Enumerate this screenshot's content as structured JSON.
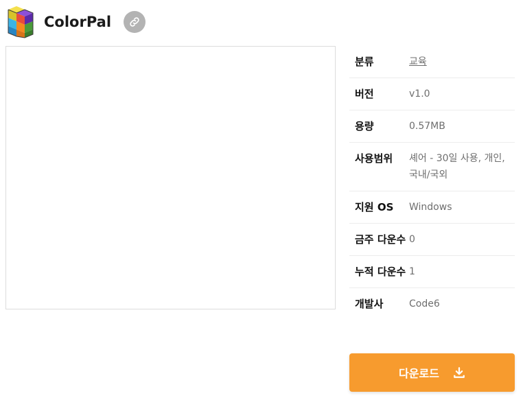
{
  "app": {
    "title": "ColorPal",
    "logo_icon": "colored-cubes-icon",
    "link_icon": "link-icon"
  },
  "info": [
    {
      "label": "분류",
      "value": "교육",
      "is_link": true
    },
    {
      "label": "버전",
      "value": "v1.0"
    },
    {
      "label": "용량",
      "value": "0.57MB"
    },
    {
      "label": "사용범위",
      "value": "셰어 - 30일 사용, 개인, 국내/국외"
    },
    {
      "label": "지원 OS",
      "value": "Windows"
    },
    {
      "label": "금주 다운수",
      "value": "0"
    },
    {
      "label": "누적 다운수",
      "value": "1"
    },
    {
      "label": "개발사",
      "value": "Code6"
    }
  ],
  "download": {
    "label": "다운로드",
    "icon": "download-icon",
    "color": "#f79b2e"
  }
}
